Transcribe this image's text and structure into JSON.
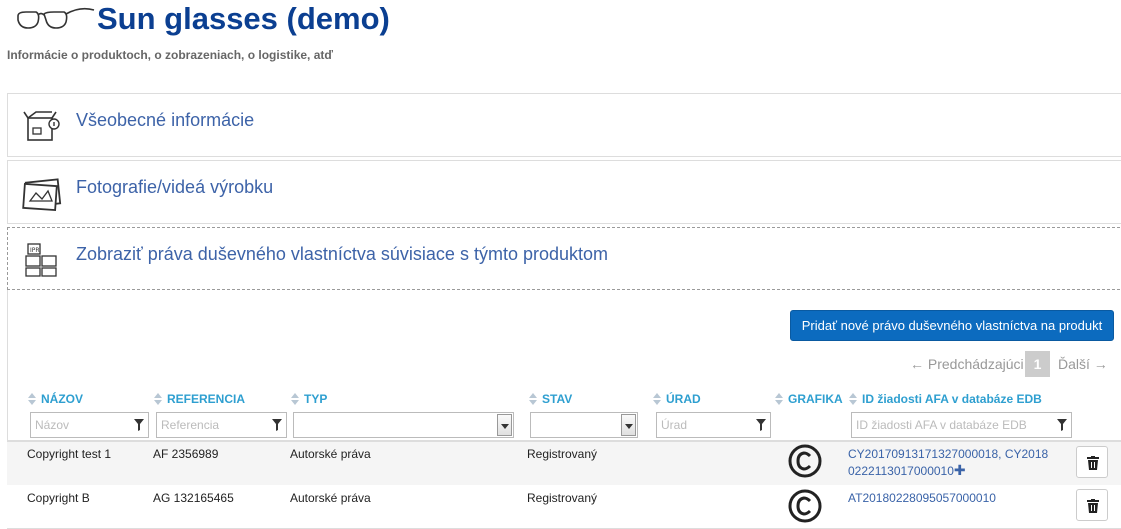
{
  "header": {
    "title": "Sun glasses (demo)",
    "subtitle": "Informácie o produktoch, o zobrazeniach, o logistike, atď"
  },
  "panels": [
    {
      "label": "Všeobecné informácie",
      "icon": "box-info-icon"
    },
    {
      "label": "Fotografie/videá výrobku",
      "icon": "photo-icon"
    },
    {
      "label": "Zobraziť práva duševného vlastníctva súvisiace s týmto produktom",
      "icon": "ipr-boxes-icon"
    }
  ],
  "actions": {
    "add_label": "Pridať nové právo duševného vlastníctva na produkt"
  },
  "pager": {
    "prev": "← Predchádzajúci",
    "page": "1",
    "next": "Ďalší →"
  },
  "table": {
    "columns": [
      "NÁZOV",
      "REFERENCIA",
      "TYP",
      "STAV",
      "ÚRAD",
      "GRAFIKA",
      "ID žiadosti AFA v databáze EDB"
    ],
    "filters": {
      "name_placeholder": "Názov",
      "reference_placeholder": "Referencia",
      "office_placeholder": "Úrad",
      "afa_placeholder": "ID žiadosti AFA v databáze EDB"
    },
    "rows": [
      {
        "name": "Copyright test 1",
        "reference": "AF 2356989",
        "type": "Autorské práva",
        "status": "Registrovaný",
        "office": "",
        "afa_line1": "CY20170913171327000018, CY2018",
        "afa_line2": "0222113017000010",
        "afa_more": "✚"
      },
      {
        "name": "Copyright B",
        "reference": "AG 132165465",
        "type": "Autorské práva",
        "status": "Registrovaný",
        "office": "",
        "afa_line1": "AT20180228095057000010",
        "afa_line2": "",
        "afa_more": ""
      }
    ]
  },
  "colors": {
    "title": "#0b3f91",
    "header_text": "#2e9fd0",
    "link": "#3a63a8",
    "button": "#0c6bbf"
  }
}
